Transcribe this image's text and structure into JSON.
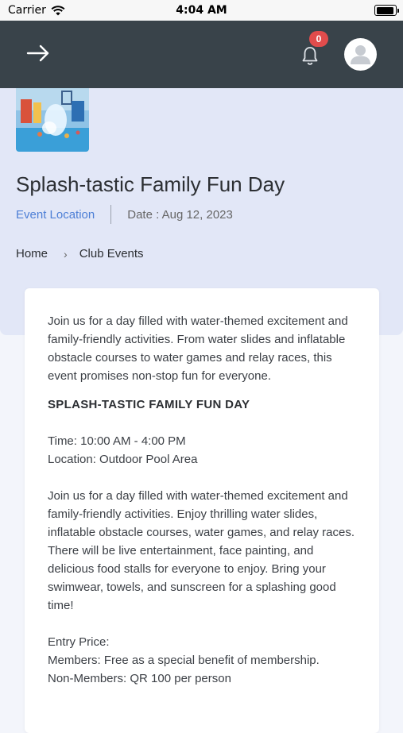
{
  "status_bar": {
    "carrier": "Carrier",
    "time": "4:04 AM"
  },
  "header": {
    "notification_count": "0"
  },
  "event": {
    "title": "Splash-tastic Family Fun Day",
    "location_link": "Event Location",
    "date_label": "Date : Aug 12, 2023"
  },
  "breadcrumb": {
    "home": "Home",
    "current": "Club Events"
  },
  "description": {
    "intro": "Join us for a day filled with water-themed excitement and family-friendly activities. From water slides and inflatable obstacle courses to water games and relay races, this event promises non-stop fun for everyone.",
    "heading": "SPLASH-TASTIC FAMILY FUN DAY",
    "time": "Time: 10:00 AM - 4:00 PM",
    "location": "Location: Outdoor Pool Area",
    "details": "Join us for a day filled with water-themed excitement and family-friendly activities. Enjoy thrilling water slides, inflatable obstacle courses, water games, and relay races. There will be live entertainment, face painting, and delicious food stalls for everyone to enjoy. Bring your swimwear, towels, and sunscreen for a splashing good time!",
    "entry_price_label": "Entry Price:",
    "members_price": "Members: Free as a special benefit of membership.",
    "non_members_price": "Non-Members: QR 100 per person"
  },
  "colors": {
    "header_bg": "#39434a",
    "hero_bg": "#e2e7f7",
    "link": "#4d7fd6",
    "badge": "#e24c4c"
  }
}
